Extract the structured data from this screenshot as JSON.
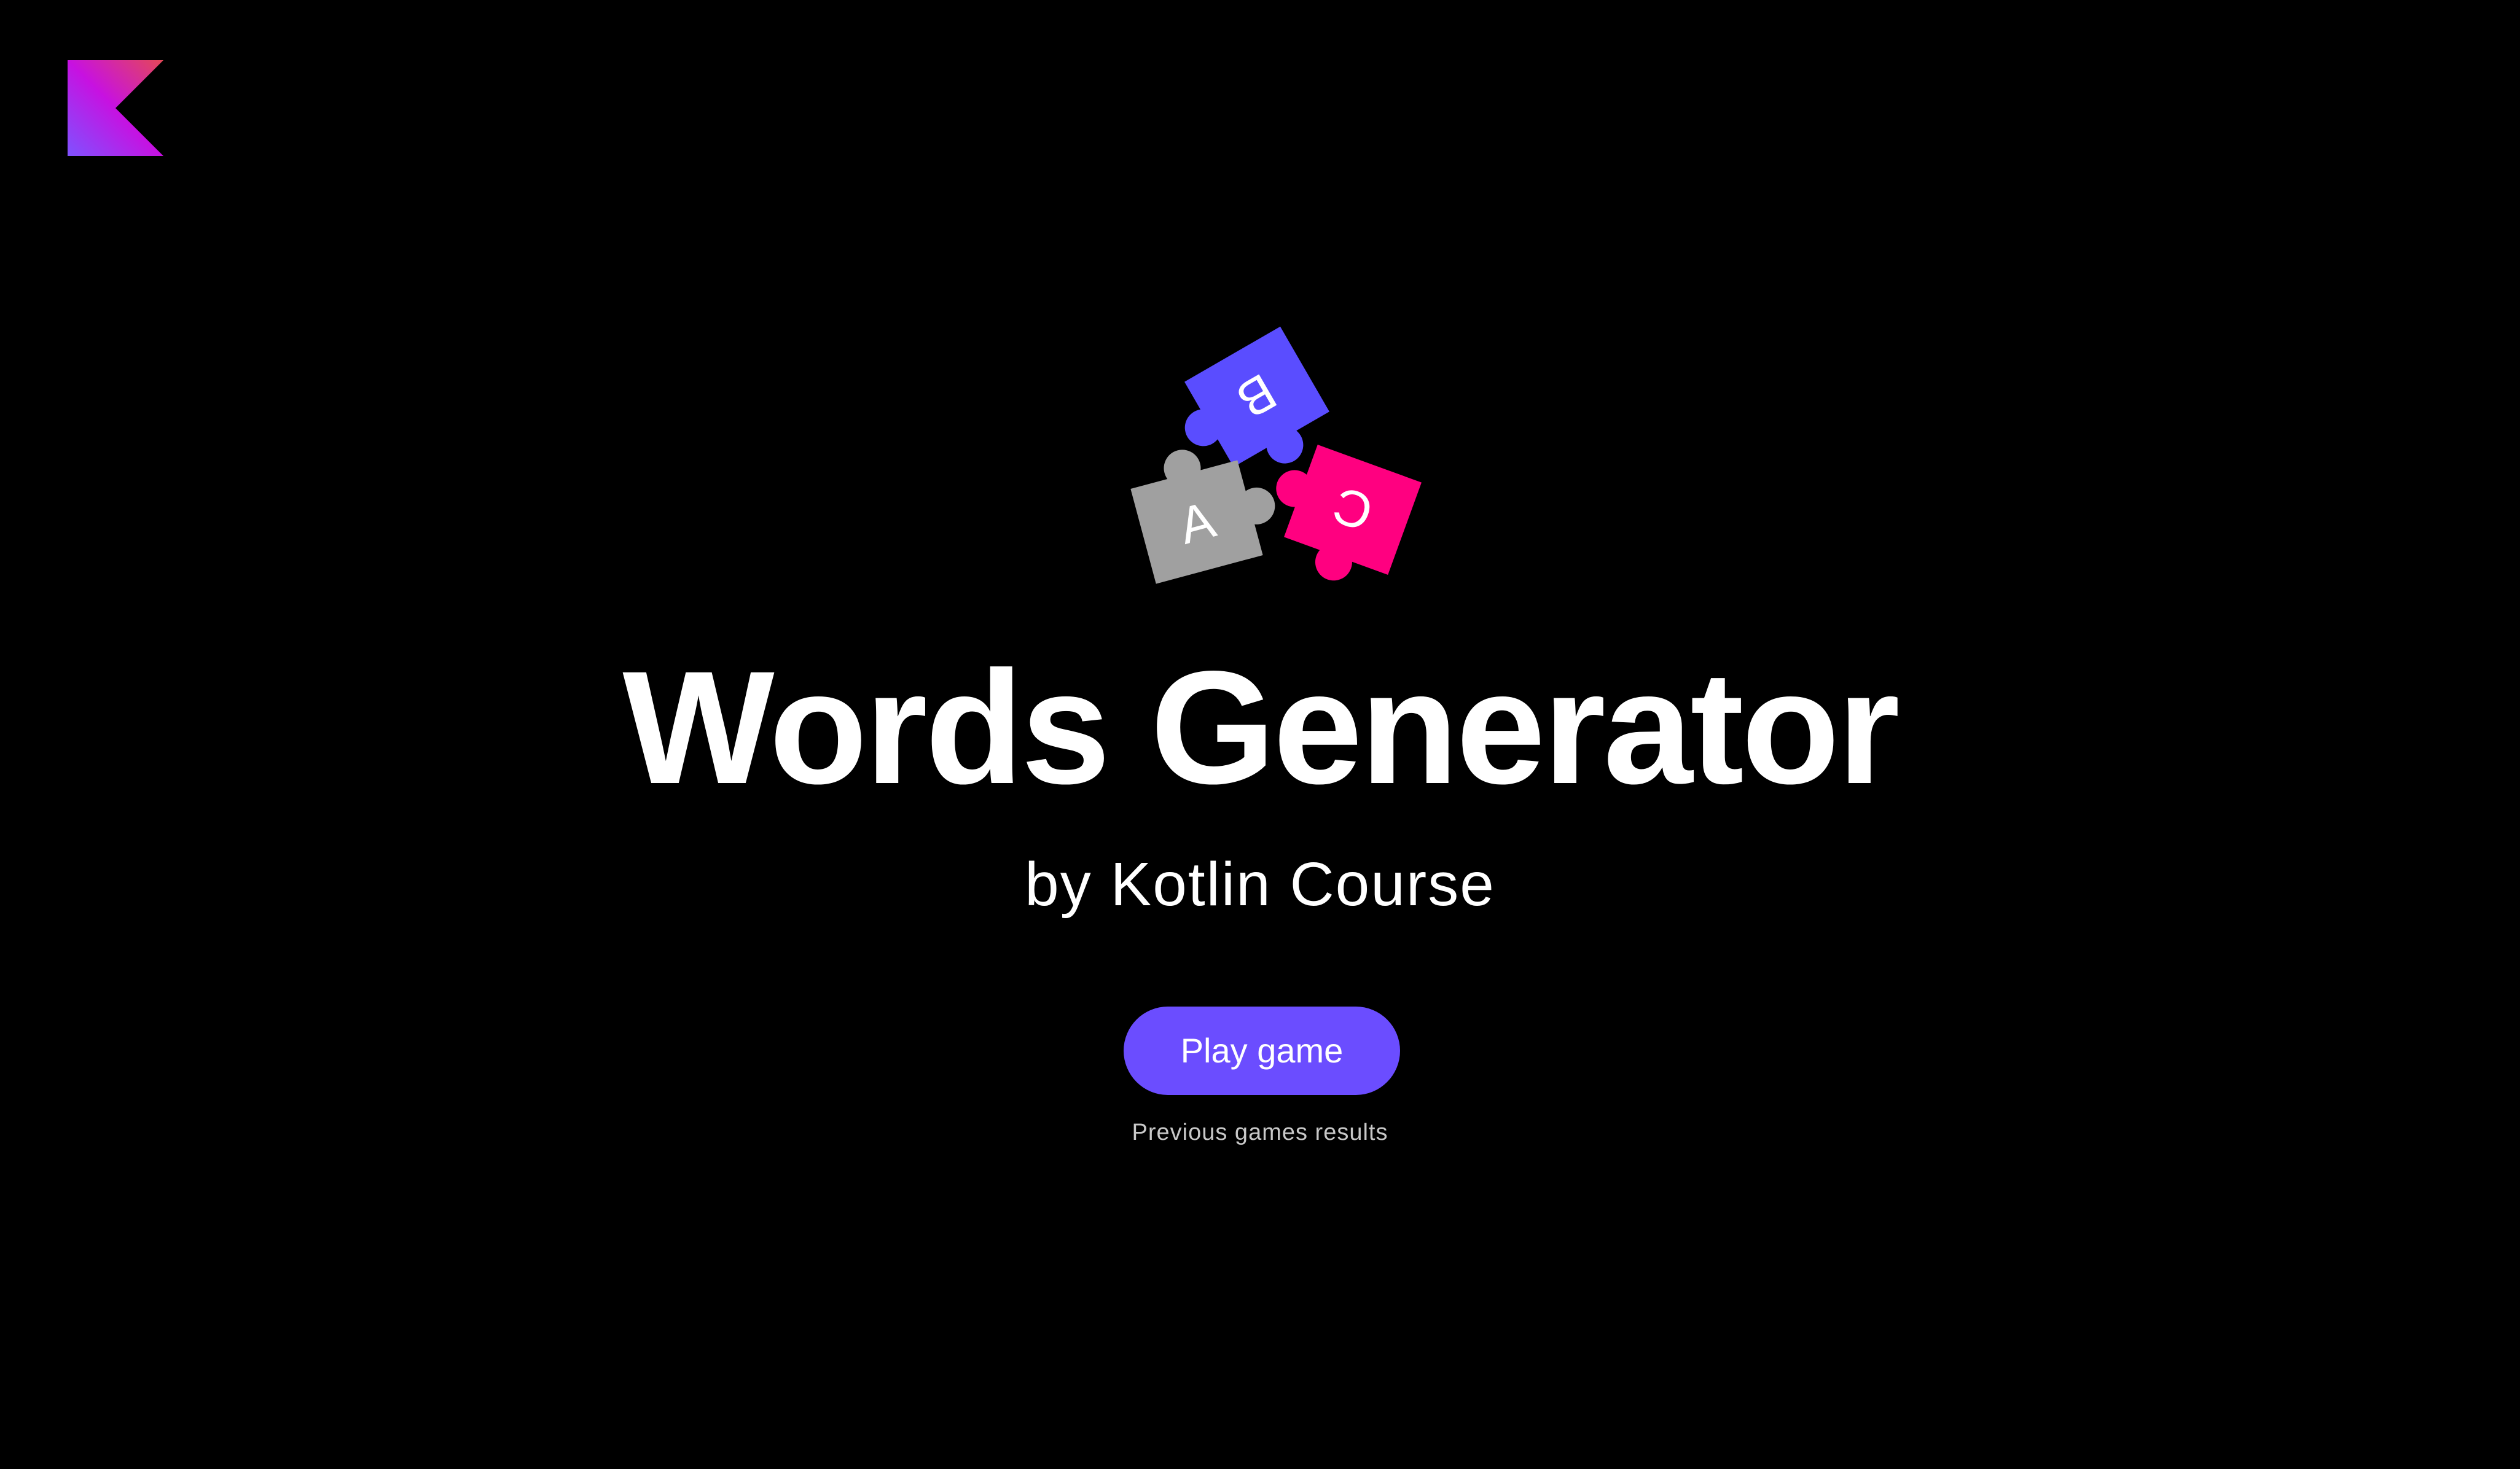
{
  "logo": {
    "name": "kotlin-logo-icon",
    "colors": [
      "#7f52ff",
      "#c711e1",
      "#e44857"
    ]
  },
  "hero": {
    "pieces": [
      {
        "letter": "A",
        "color": "#a0a0a0"
      },
      {
        "letter": "B",
        "color": "#5a4dff"
      },
      {
        "letter": "C",
        "color": "#ff0080"
      }
    ]
  },
  "title": "Words Generator",
  "subtitle": "by Kotlin Course",
  "play_button": {
    "label": "Play game",
    "color": "#6b4dff"
  },
  "results_link": "Previous games results",
  "background": "#000000"
}
